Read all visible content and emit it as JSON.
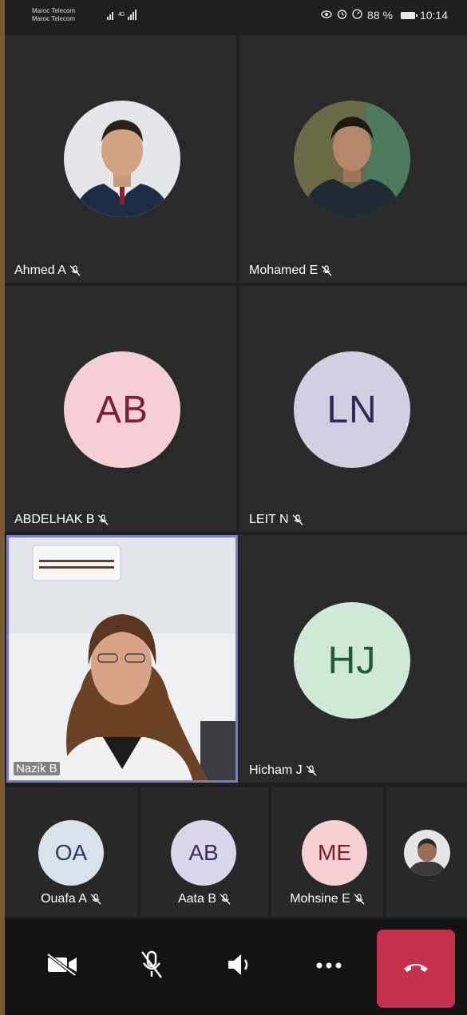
{
  "status_bar": {
    "carrier_1": "Maroc Telecom",
    "carrier_2": "Maroc Telecom",
    "battery": "88 %",
    "time": "10:14"
  },
  "grid": [
    {
      "name": "Ahmed A",
      "muted": true,
      "kind": "photo"
    },
    {
      "name": "Mohamed E",
      "muted": true,
      "kind": "photo"
    },
    {
      "name": "ABDELHAK B",
      "muted": true,
      "kind": "initials",
      "initials": "AB",
      "bg": "#f4cfd6",
      "fg": "#7a1f3a"
    },
    {
      "name": "LEIT N",
      "muted": true,
      "kind": "initials",
      "initials": "LN",
      "bg": "#d3cfe3",
      "fg": "#2c2a5a"
    },
    {
      "name": "Nazik B",
      "muted": false,
      "kind": "video"
    },
    {
      "name": "Hicham J",
      "muted": true,
      "kind": "initials",
      "initials": "HJ",
      "bg": "#cfe8d8",
      "fg": "#1f5a3a"
    }
  ],
  "strip": [
    {
      "name": "Ouafa A",
      "initials": "OA",
      "bg": "#d9e2ea",
      "fg": "#244058"
    },
    {
      "name": "Aata B",
      "initials": "AB",
      "bg": "#dcd6ec",
      "fg": "#3a2d62"
    },
    {
      "name": "Mohsine E",
      "initials": "ME",
      "bg": "#f6d0d2",
      "fg": "#7a1f2a"
    }
  ],
  "colors": {
    "active_speaker_border": "#7a7bd6",
    "hangup": "#c4314b",
    "background": "#1f1f1f"
  },
  "toolbar": {
    "icons": [
      "camera-off-icon",
      "mic-off-icon",
      "speaker-icon",
      "more-icon",
      "hang-up-icon"
    ]
  }
}
